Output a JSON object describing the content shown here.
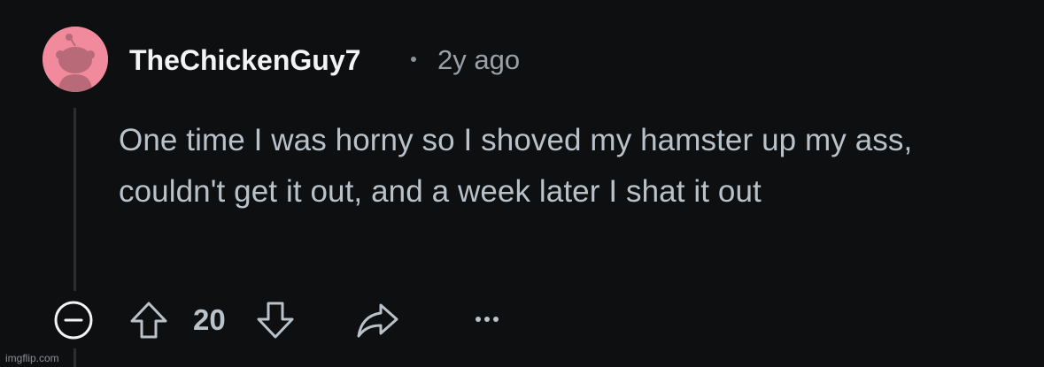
{
  "comment": {
    "username": "TheChickenGuy7",
    "timestamp": "2y ago",
    "body": "One time I was horny so I shoved my hamster up my ass, couldn't get it out, and a week later I shat it out",
    "avatar_icon": "reddit-snoo-avatar-icon",
    "avatar_color": "#f08a9c"
  },
  "actions": {
    "collapse_icon": "collapse-minus-icon",
    "upvote_icon": "upvote-arrow-icon",
    "score": "20",
    "downvote_icon": "downvote-arrow-icon",
    "share_icon": "share-arrow-icon",
    "more_icon": "more-options-icon"
  },
  "watermark": "imgflip.com",
  "colors": {
    "background": "#0e0f11",
    "username": "#f1f3f4",
    "body_text": "#b9c2c9",
    "meta_text": "#9aa1a6",
    "icon": "#b9c2c9"
  }
}
